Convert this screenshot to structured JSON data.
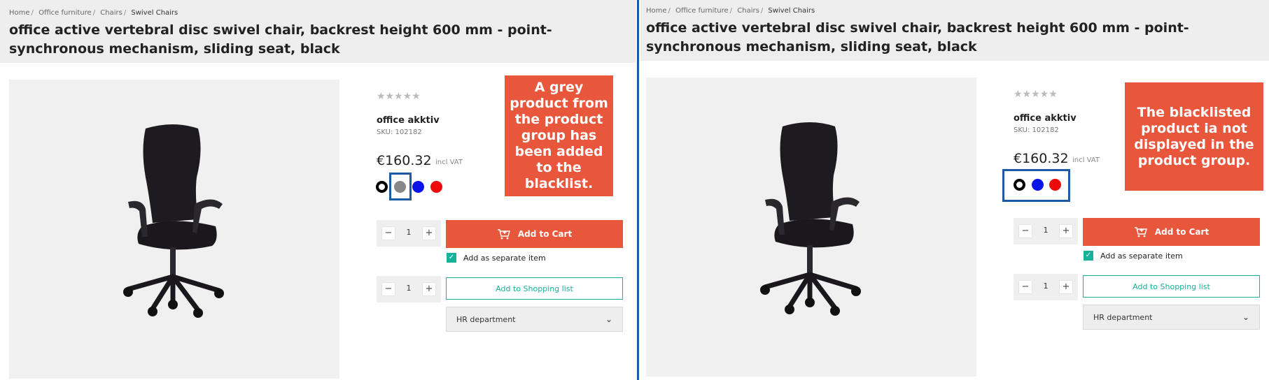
{
  "breadcrumb": [
    "Home",
    "Office furniture",
    "Chairs",
    "Swivel Chairs"
  ],
  "breadcrumb_separator": "/",
  "product": {
    "title": "office active vertebral disc swivel chair, backrest height 600 mm - point-synchronous mechanism, sliding seat, black",
    "stars": "★★★★★",
    "brand": "office akktiv",
    "sku": "SKU: 102182",
    "price": "€160.32",
    "vat": "incl VAT"
  },
  "cart": {
    "quantity": "1",
    "minus": "−",
    "plus": "+",
    "add_to_cart": "Add to Cart",
    "separate_item": "Add as separate item",
    "separate_item_checked": true,
    "list_quantity": "1",
    "add_to_list": "Add to Shopping list",
    "department": "HR department",
    "chevron": "⌄"
  },
  "left_panel": {
    "swatch_colors": [
      "#000000",
      "#888888",
      "#0a14e6",
      "#ee0a0a"
    ],
    "callout": "A grey product from the product group has been added to the blacklist."
  },
  "right_panel": {
    "swatch_colors": [
      "#000000",
      "#0a14e6",
      "#ee0a0a"
    ],
    "callout": "The blacklisted product ia not displayed in the product group."
  },
  "colors": {
    "accent": "#e8563c",
    "teal": "#17b29a",
    "highlight": "#1c5aa6"
  }
}
